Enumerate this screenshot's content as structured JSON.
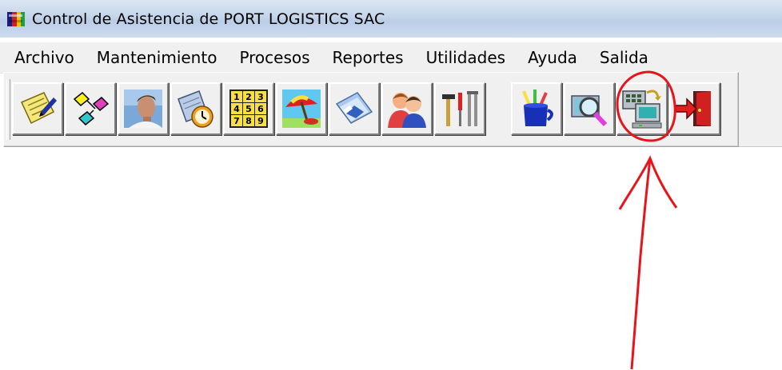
{
  "window": {
    "title": "Control de Asistencia de PORT LOGISTICS SAC",
    "app_icon": "colorful-blocks-icon"
  },
  "menu": {
    "items": [
      "Archivo",
      "Mantenimiento",
      "Procesos",
      "Reportes",
      "Utilidades",
      "Ayuda",
      "Salida"
    ]
  },
  "toolbar": {
    "buttons": [
      {
        "icon": "notepad-pen-icon"
      },
      {
        "icon": "flowchart-icon"
      },
      {
        "icon": "person-photo-icon"
      },
      {
        "icon": "calendar-clock-icon"
      },
      {
        "icon": "number-keypad-icon"
      },
      {
        "icon": "beach-umbrella-icon"
      },
      {
        "icon": "cards-icon"
      },
      {
        "icon": "two-people-icon"
      },
      {
        "icon": "tools-icon"
      },
      {
        "icon": "pencil-cup-icon"
      },
      {
        "icon": "magnifier-search-icon"
      },
      {
        "icon": "computer-terminal-icon",
        "highlighted": true
      },
      {
        "icon": "exit-door-icon"
      }
    ]
  },
  "annotation": {
    "color": "#e8141b"
  }
}
